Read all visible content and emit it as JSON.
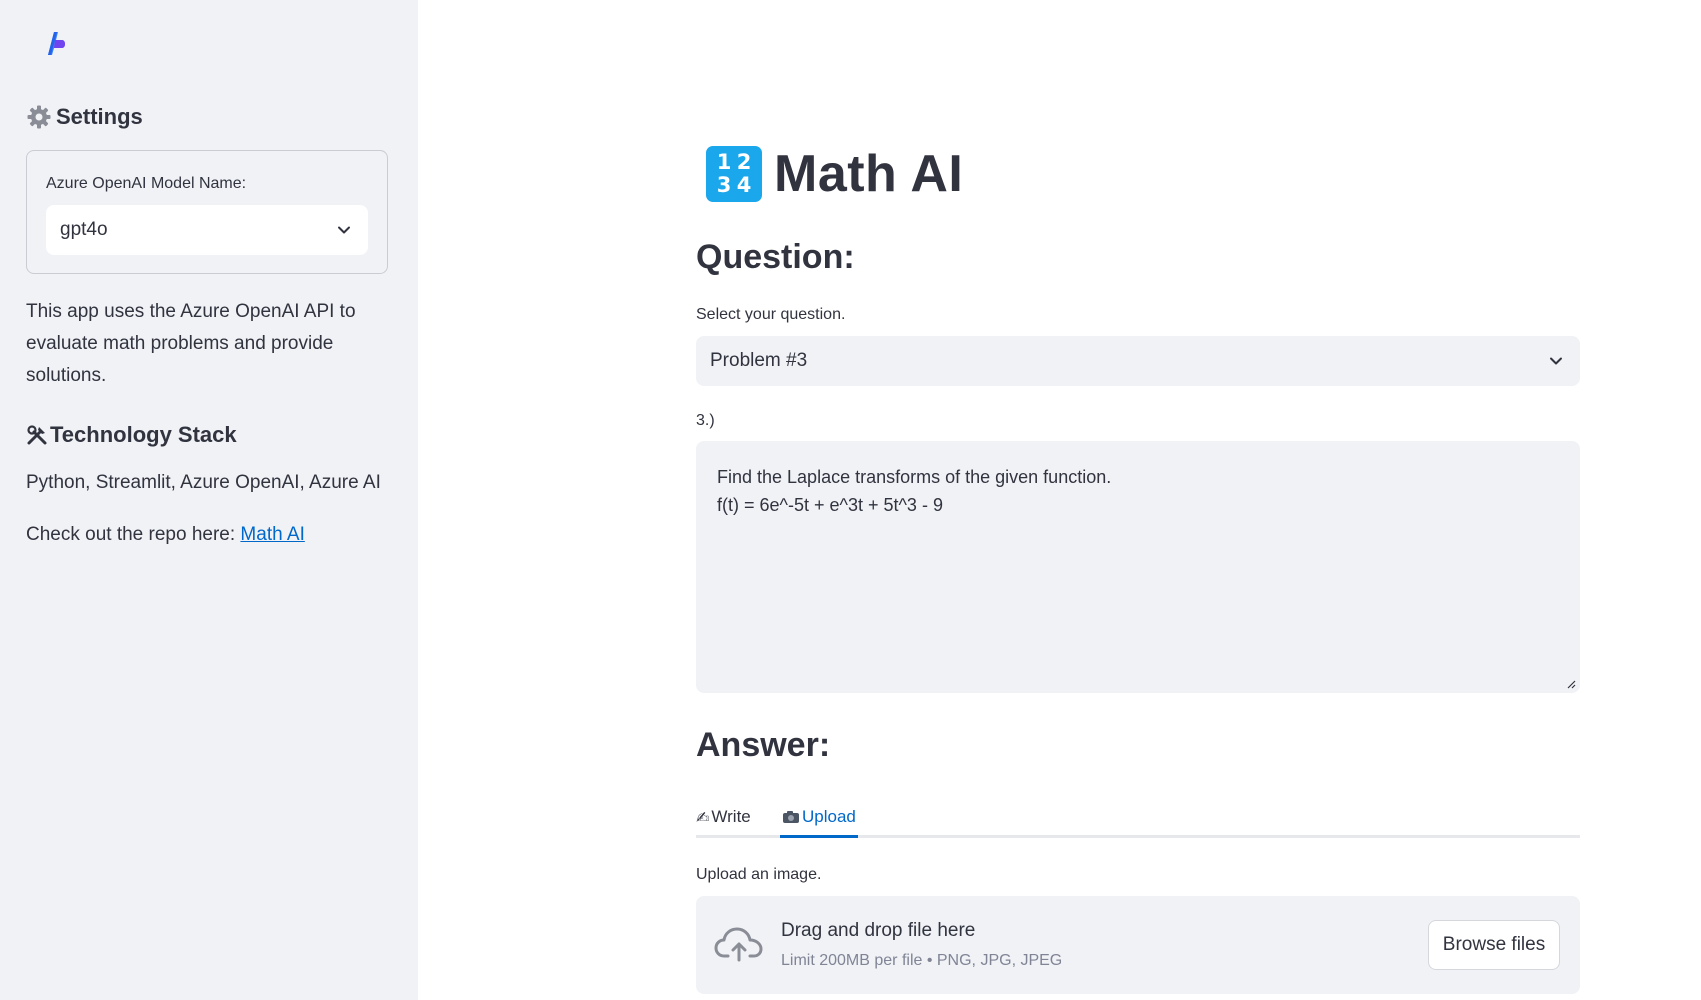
{
  "sidebar": {
    "settings_title": "Settings",
    "model_label": "Azure OpenAI Model Name:",
    "model_value": "gpt4o",
    "about_text": "This app uses the Azure OpenAI API to evaluate math problems and provide solutions.",
    "tech_title": "Technology Stack",
    "tech_list": "Python, Streamlit, Azure OpenAI, Azure AI",
    "repo_prefix": "Check out the repo here:",
    "repo_link": "Math AI"
  },
  "main": {
    "title": "Math AI",
    "title_icon_digits": [
      "1",
      "2",
      "3",
      "4"
    ],
    "question_heading": "Question:",
    "question_select_label": "Select your question.",
    "question_select_value": "Problem #3",
    "question_number": "3.)",
    "question_text_line1": "Find the Laplace transforms of the given function.",
    "question_text_line2": "f(t) = 6e^-5t + e^3t + 5t^3 - 9",
    "answer_heading": "Answer:",
    "tabs": [
      {
        "label": "Write",
        "icon": "writing-hand-icon",
        "active": false
      },
      {
        "label": "Upload",
        "icon": "camera-icon",
        "active": true
      }
    ],
    "upload_label": "Upload an image.",
    "dropzone_title": "Drag and drop file here",
    "dropzone_subtitle": "Limit 200MB per file • PNG, JPG, JPEG",
    "browse_button": "Browse files"
  },
  "colors": {
    "sidebar_bg": "#f0f2f6",
    "accent": "#0068c9",
    "text": "#31333f",
    "icon_blue": "#1aa7ec"
  }
}
